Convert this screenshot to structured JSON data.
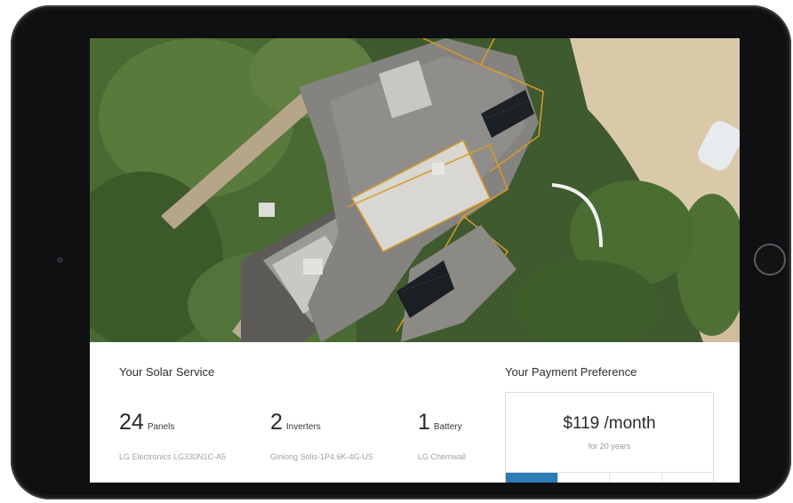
{
  "solar_service": {
    "title": "Your Solar Service",
    "items": [
      {
        "count": "24",
        "unit": "Panels",
        "model": "LG Electronics LG330N1C-A5"
      },
      {
        "count": "2",
        "unit": "Inverters",
        "model": "Ginlong Solis-1P4.6K-4G-US"
      },
      {
        "count": "1",
        "unit": "Battery",
        "model": "LG Chemwall"
      }
    ]
  },
  "payment_preference": {
    "title": "Your Payment Preference",
    "amount": "$119 /month",
    "term": "for 20 years",
    "selected_segment": 0
  },
  "colors": {
    "accent": "#2b7bb5",
    "roof_outline": "#d89a2c",
    "device_bezel": "#0f1012"
  }
}
